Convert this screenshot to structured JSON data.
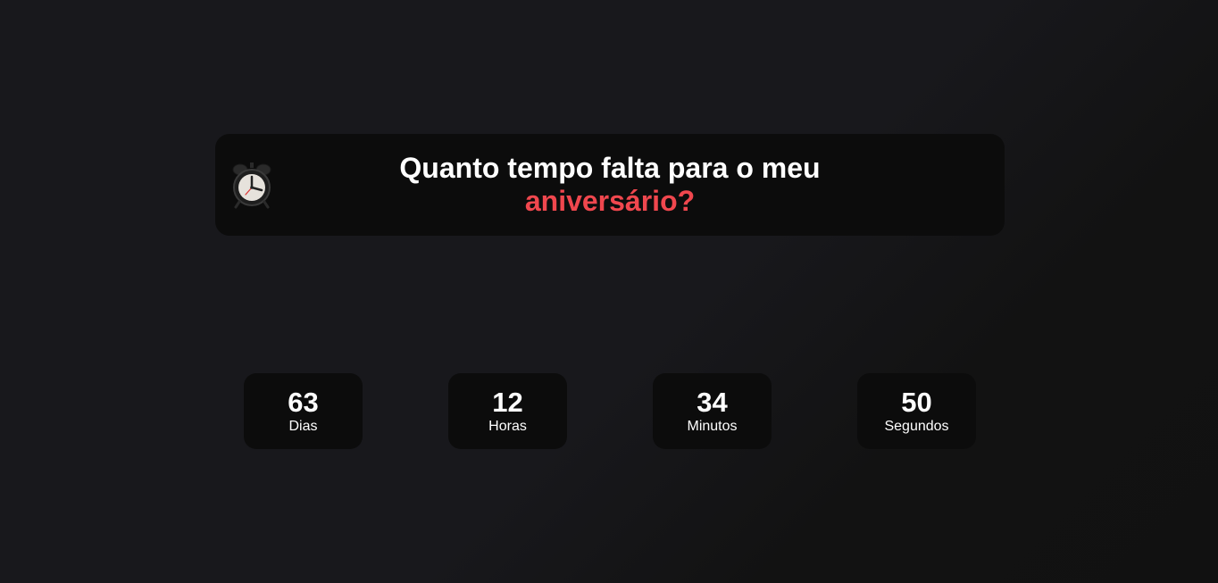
{
  "header": {
    "title_line1": "Quanto tempo falta para o meu",
    "title_line2": "aniversário?",
    "icon": "alarm-clock-icon",
    "accent_color": "#f0474e"
  },
  "countdown": [
    {
      "value": "63",
      "label": "Dias"
    },
    {
      "value": "12",
      "label": "Horas"
    },
    {
      "value": "34",
      "label": "Minutos"
    },
    {
      "value": "50",
      "label": "Segundos"
    }
  ]
}
